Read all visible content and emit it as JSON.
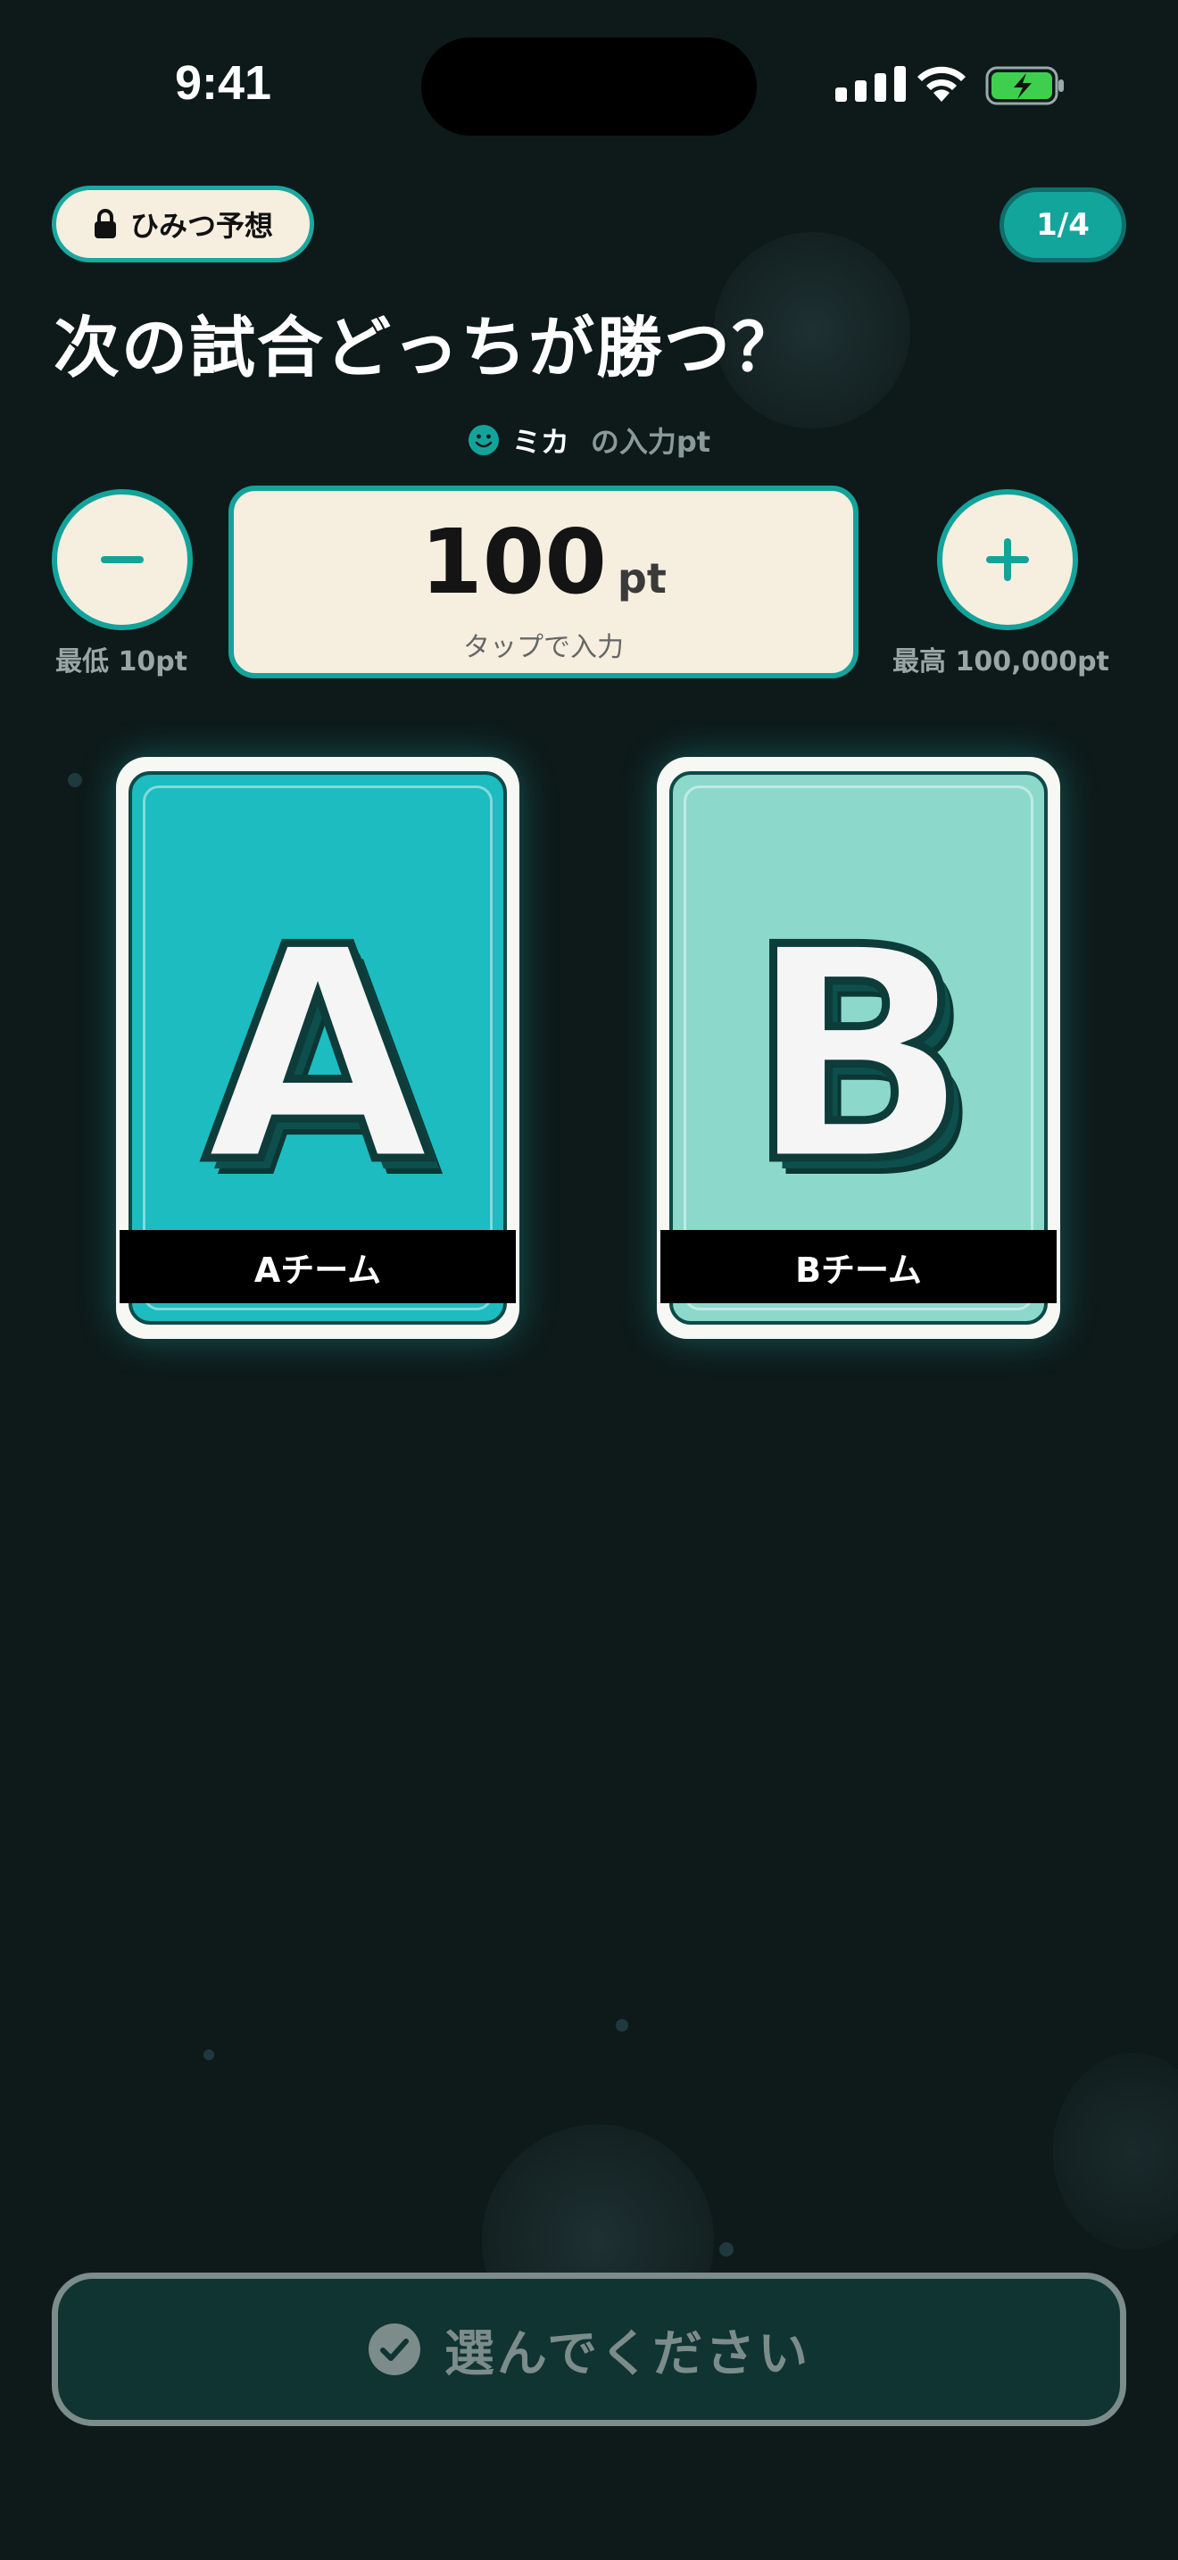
{
  "status_bar": {
    "time": "9:41"
  },
  "header": {
    "secret_label": "ひみつ予想",
    "progress": "1/4"
  },
  "question": "次の試合どっちが勝つ？",
  "player": {
    "name": "ミカ",
    "suffix": "の入力pt"
  },
  "stepper": {
    "min_label": "最低 10pt",
    "max_label": "最高 100,000pt",
    "value": "100",
    "unit": "pt",
    "hint": "タップで入力"
  },
  "teams": [
    {
      "letter": "A",
      "label": "Aチーム",
      "color": "#1cbcc0"
    },
    {
      "letter": "B",
      "label": "Bチーム",
      "color": "#8cd9cc"
    }
  ],
  "submit": {
    "label": "選んでください"
  },
  "colors": {
    "accent": "#14a39a",
    "background": "#0e1a1a",
    "cream": "#f6efe0"
  }
}
